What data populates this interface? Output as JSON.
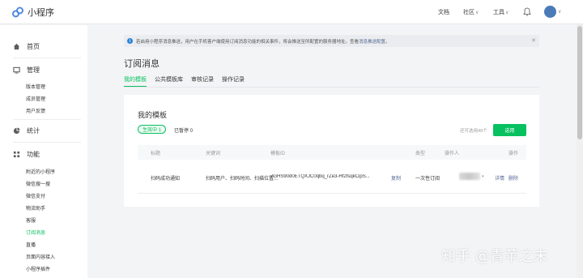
{
  "app": {
    "name": "小程序"
  },
  "topnav": {
    "docs": "文档",
    "community": "社区",
    "tools": "工具"
  },
  "sidebar": {
    "home": "首页",
    "manage": "管理",
    "manage_items": [
      "版本管理",
      "成员管理",
      "用户反馈"
    ],
    "stats": "统计",
    "features": "功能",
    "feature_items": [
      "附近的小程序",
      "微信搜一搜",
      "微信支付",
      "物流助手",
      "客服",
      "订阅消息",
      "直播",
      "页面内容接入",
      "小程序插件"
    ],
    "active_item": "订阅消息"
  },
  "notice": {
    "text": "若启用小程序消息推送，用户在手机客户端使用订阅消息功能的相关事件，将会推送至所配置的服务器地址。查看",
    "link": "消息推送配置",
    "suffix": "。"
  },
  "page": {
    "title": "订阅消息",
    "tabs": [
      "我的模板",
      "公共模板库",
      "审核记录",
      "操作记录"
    ]
  },
  "card": {
    "title": "我的模板",
    "status_active": "生效中 1",
    "status_stopped": "已暂停 0",
    "quota": "还可选用49个",
    "select_button": "选用"
  },
  "table": {
    "headers": [
      "标题",
      "关键词",
      "模板ID",
      "类型",
      "操作人",
      "操作"
    ],
    "rows": [
      {
        "title": "扫码成功通知",
        "keywords": "扫码用户、扫码时间、扫描位置...",
        "template_id": "7GHS90d0ETQXJC0qbq_rZe3-Hf2fsqkCipS...",
        "copy": "复制",
        "type": "一次性订阅",
        "detail": "详情",
        "delete": "删除"
      }
    ]
  },
  "watermark": "知乎 @青苹之末",
  "colors": {
    "accent": "#07c160",
    "link": "#576b95"
  }
}
